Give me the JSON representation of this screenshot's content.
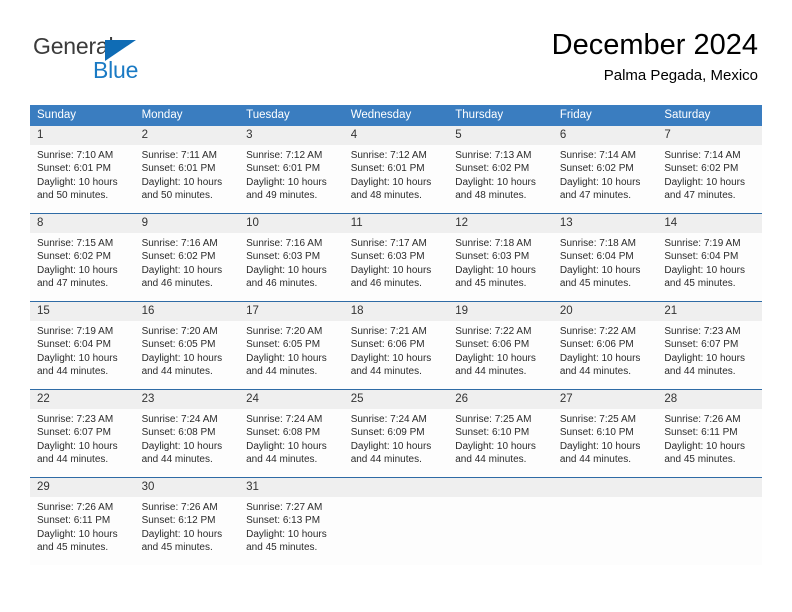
{
  "brand": {
    "name_part1": "General",
    "name_part2": "Blue",
    "triangle_color": "#0f6cb5",
    "blue_color": "#1a7ac4",
    "gray_color": "#3b3b3b"
  },
  "header": {
    "title": "December 2024",
    "subtitle": "Palma Pegada, Mexico"
  },
  "colors": {
    "header_row_bg": "#3a7dc0",
    "header_row_text": "#ffffff",
    "daynum_bg": "#efefef",
    "week_separator": "#2f6ba5",
    "cell_bg": "#fdfdfd"
  },
  "weekdays": [
    "Sunday",
    "Monday",
    "Tuesday",
    "Wednesday",
    "Thursday",
    "Friday",
    "Saturday"
  ],
  "weeks": [
    [
      {
        "day": "1",
        "sunrise": "Sunrise: 7:10 AM",
        "sunset": "Sunset: 6:01 PM",
        "daylight": "Daylight: 10 hours and 50 minutes."
      },
      {
        "day": "2",
        "sunrise": "Sunrise: 7:11 AM",
        "sunset": "Sunset: 6:01 PM",
        "daylight": "Daylight: 10 hours and 50 minutes."
      },
      {
        "day": "3",
        "sunrise": "Sunrise: 7:12 AM",
        "sunset": "Sunset: 6:01 PM",
        "daylight": "Daylight: 10 hours and 49 minutes."
      },
      {
        "day": "4",
        "sunrise": "Sunrise: 7:12 AM",
        "sunset": "Sunset: 6:01 PM",
        "daylight": "Daylight: 10 hours and 48 minutes."
      },
      {
        "day": "5",
        "sunrise": "Sunrise: 7:13 AM",
        "sunset": "Sunset: 6:02 PM",
        "daylight": "Daylight: 10 hours and 48 minutes."
      },
      {
        "day": "6",
        "sunrise": "Sunrise: 7:14 AM",
        "sunset": "Sunset: 6:02 PM",
        "daylight": "Daylight: 10 hours and 47 minutes."
      },
      {
        "day": "7",
        "sunrise": "Sunrise: 7:14 AM",
        "sunset": "Sunset: 6:02 PM",
        "daylight": "Daylight: 10 hours and 47 minutes."
      }
    ],
    [
      {
        "day": "8",
        "sunrise": "Sunrise: 7:15 AM",
        "sunset": "Sunset: 6:02 PM",
        "daylight": "Daylight: 10 hours and 47 minutes."
      },
      {
        "day": "9",
        "sunrise": "Sunrise: 7:16 AM",
        "sunset": "Sunset: 6:02 PM",
        "daylight": "Daylight: 10 hours and 46 minutes."
      },
      {
        "day": "10",
        "sunrise": "Sunrise: 7:16 AM",
        "sunset": "Sunset: 6:03 PM",
        "daylight": "Daylight: 10 hours and 46 minutes."
      },
      {
        "day": "11",
        "sunrise": "Sunrise: 7:17 AM",
        "sunset": "Sunset: 6:03 PM",
        "daylight": "Daylight: 10 hours and 46 minutes."
      },
      {
        "day": "12",
        "sunrise": "Sunrise: 7:18 AM",
        "sunset": "Sunset: 6:03 PM",
        "daylight": "Daylight: 10 hours and 45 minutes."
      },
      {
        "day": "13",
        "sunrise": "Sunrise: 7:18 AM",
        "sunset": "Sunset: 6:04 PM",
        "daylight": "Daylight: 10 hours and 45 minutes."
      },
      {
        "day": "14",
        "sunrise": "Sunrise: 7:19 AM",
        "sunset": "Sunset: 6:04 PM",
        "daylight": "Daylight: 10 hours and 45 minutes."
      }
    ],
    [
      {
        "day": "15",
        "sunrise": "Sunrise: 7:19 AM",
        "sunset": "Sunset: 6:04 PM",
        "daylight": "Daylight: 10 hours and 44 minutes."
      },
      {
        "day": "16",
        "sunrise": "Sunrise: 7:20 AM",
        "sunset": "Sunset: 6:05 PM",
        "daylight": "Daylight: 10 hours and 44 minutes."
      },
      {
        "day": "17",
        "sunrise": "Sunrise: 7:20 AM",
        "sunset": "Sunset: 6:05 PM",
        "daylight": "Daylight: 10 hours and 44 minutes."
      },
      {
        "day": "18",
        "sunrise": "Sunrise: 7:21 AM",
        "sunset": "Sunset: 6:06 PM",
        "daylight": "Daylight: 10 hours and 44 minutes."
      },
      {
        "day": "19",
        "sunrise": "Sunrise: 7:22 AM",
        "sunset": "Sunset: 6:06 PM",
        "daylight": "Daylight: 10 hours and 44 minutes."
      },
      {
        "day": "20",
        "sunrise": "Sunrise: 7:22 AM",
        "sunset": "Sunset: 6:06 PM",
        "daylight": "Daylight: 10 hours and 44 minutes."
      },
      {
        "day": "21",
        "sunrise": "Sunrise: 7:23 AM",
        "sunset": "Sunset: 6:07 PM",
        "daylight": "Daylight: 10 hours and 44 minutes."
      }
    ],
    [
      {
        "day": "22",
        "sunrise": "Sunrise: 7:23 AM",
        "sunset": "Sunset: 6:07 PM",
        "daylight": "Daylight: 10 hours and 44 minutes."
      },
      {
        "day": "23",
        "sunrise": "Sunrise: 7:24 AM",
        "sunset": "Sunset: 6:08 PM",
        "daylight": "Daylight: 10 hours and 44 minutes."
      },
      {
        "day": "24",
        "sunrise": "Sunrise: 7:24 AM",
        "sunset": "Sunset: 6:08 PM",
        "daylight": "Daylight: 10 hours and 44 minutes."
      },
      {
        "day": "25",
        "sunrise": "Sunrise: 7:24 AM",
        "sunset": "Sunset: 6:09 PM",
        "daylight": "Daylight: 10 hours and 44 minutes."
      },
      {
        "day": "26",
        "sunrise": "Sunrise: 7:25 AM",
        "sunset": "Sunset: 6:10 PM",
        "daylight": "Daylight: 10 hours and 44 minutes."
      },
      {
        "day": "27",
        "sunrise": "Sunrise: 7:25 AM",
        "sunset": "Sunset: 6:10 PM",
        "daylight": "Daylight: 10 hours and 44 minutes."
      },
      {
        "day": "28",
        "sunrise": "Sunrise: 7:26 AM",
        "sunset": "Sunset: 6:11 PM",
        "daylight": "Daylight: 10 hours and 45 minutes."
      }
    ],
    [
      {
        "day": "29",
        "sunrise": "Sunrise: 7:26 AM",
        "sunset": "Sunset: 6:11 PM",
        "daylight": "Daylight: 10 hours and 45 minutes."
      },
      {
        "day": "30",
        "sunrise": "Sunrise: 7:26 AM",
        "sunset": "Sunset: 6:12 PM",
        "daylight": "Daylight: 10 hours and 45 minutes."
      },
      {
        "day": "31",
        "sunrise": "Sunrise: 7:27 AM",
        "sunset": "Sunset: 6:13 PM",
        "daylight": "Daylight: 10 hours and 45 minutes."
      },
      {
        "day": "",
        "sunrise": "",
        "sunset": "",
        "daylight": ""
      },
      {
        "day": "",
        "sunrise": "",
        "sunset": "",
        "daylight": ""
      },
      {
        "day": "",
        "sunrise": "",
        "sunset": "",
        "daylight": ""
      },
      {
        "day": "",
        "sunrise": "",
        "sunset": "",
        "daylight": ""
      }
    ]
  ]
}
